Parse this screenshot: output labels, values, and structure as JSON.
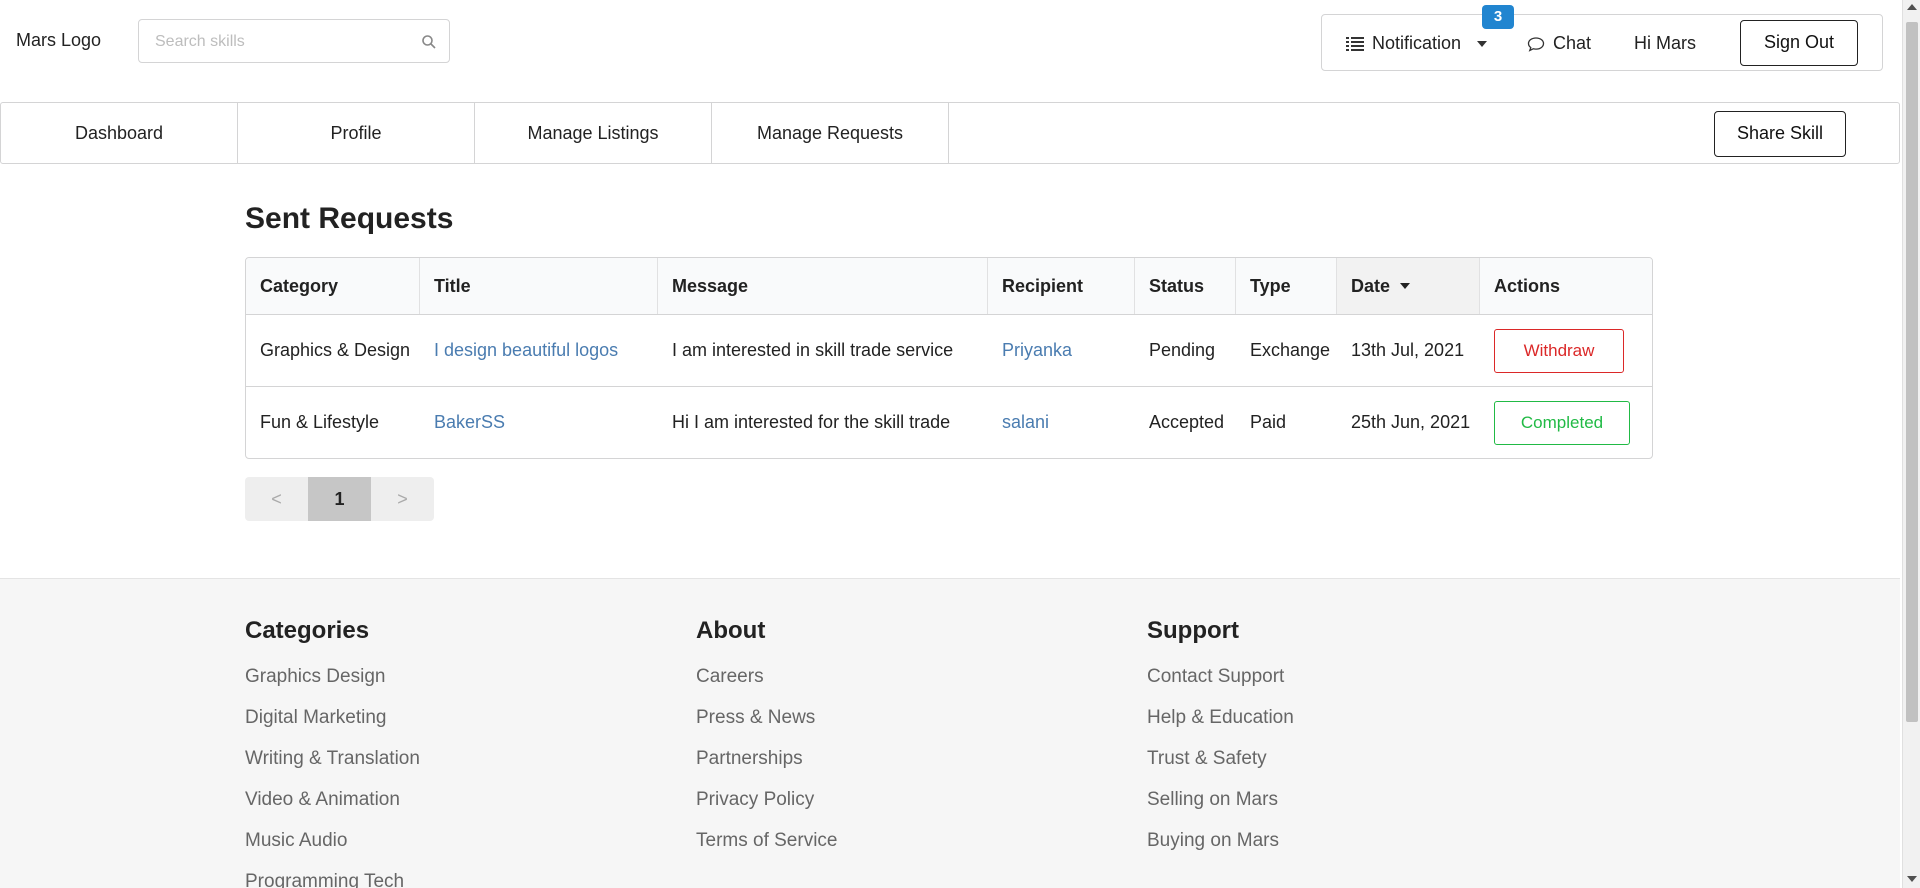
{
  "header": {
    "logo": "Mars Logo",
    "search_placeholder": "Search skills",
    "notification_label": "Notification",
    "notification_count": "3",
    "chat_label": "Chat",
    "greeting": "Hi Mars",
    "signout_label": "Sign Out"
  },
  "nav": {
    "items": [
      "Dashboard",
      "Profile",
      "Manage Listings",
      "Manage Requests"
    ],
    "share_label": "Share Skill"
  },
  "main": {
    "title": "Sent Requests",
    "columns": [
      "Category",
      "Title",
      "Message",
      "Recipient",
      "Status",
      "Type",
      "Date",
      "Actions"
    ],
    "rows": [
      {
        "category": "Graphics & Design",
        "title": "I design beautiful logos",
        "message": "I am interested in skill trade service",
        "recipient": "Priyanka",
        "status": "Pending",
        "type": "Exchange",
        "date": "13th Jul, 2021",
        "action": "Withdraw"
      },
      {
        "category": "Fun & Lifestyle",
        "title": "BakerSS",
        "message": "Hi I am interested for the skill trade",
        "recipient": "salani",
        "status": "Accepted",
        "type": "Paid",
        "date": "25th Jun, 2021",
        "action": "Completed"
      }
    ],
    "pagination": {
      "prev": "<",
      "current": "1",
      "next": ">"
    }
  },
  "footer": {
    "categories": {
      "heading": "Categories",
      "links": [
        "Graphics Design",
        "Digital Marketing",
        "Writing & Translation",
        "Video & Animation",
        "Music Audio",
        "Programming Tech"
      ]
    },
    "about": {
      "heading": "About",
      "links": [
        "Careers",
        "Press & News",
        "Partnerships",
        "Privacy Policy",
        "Terms of Service"
      ]
    },
    "support": {
      "heading": "Support",
      "links": [
        "Contact Support",
        "Help & Education",
        "Trust & Safety",
        "Selling on Mars",
        "Buying on Mars"
      ]
    }
  },
  "colors": {
    "accent_blue": "#2185d0",
    "link_blue": "#4a7cb0",
    "withdraw_red": "#db2828",
    "completed_green": "#21ba45"
  }
}
